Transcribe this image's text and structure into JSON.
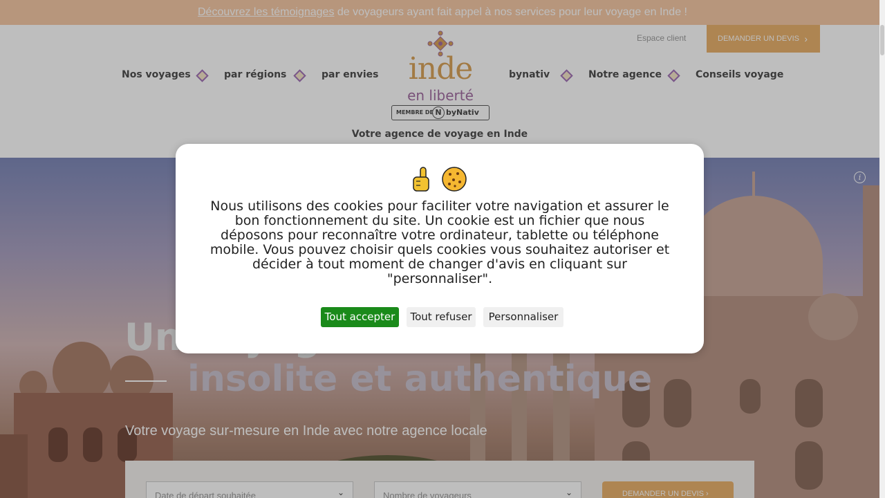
{
  "banner": {
    "link_text": "Découvrez les témoignages",
    "rest_text": " de voyageurs ayant fait appel à nos services pour leur voyage en Inde !"
  },
  "header": {
    "espace_client": "Espace client",
    "devis_button": "DEMANDER UN DEVIS",
    "nav_left": [
      "Nos voyages",
      "par régions",
      "par envies"
    ],
    "nav_right": [
      "bynativ",
      "Notre agence",
      "Conseils voyage"
    ],
    "logo": {
      "line1": "inde",
      "line2": "en liberté",
      "member": "MEMBRE DE",
      "by": "byNativ",
      "n": "N"
    },
    "tagline": "Votre agence de voyage en Inde"
  },
  "hero": {
    "title_line1": "Un voyage",
    "title_line2": "insolite et authentique",
    "subtitle": "Votre voyage sur-mesure en Inde avec notre agence locale",
    "info_icon": "i"
  },
  "form": {
    "date_placeholder": "Date de départ souhaitée",
    "travelers_placeholder": "Nombre de voyageurs",
    "devis_button": "DEMANDER UN DEVIS"
  },
  "cookie_modal": {
    "text": "Nous utilisons des cookies pour faciliter votre navigation et assurer le bon fonctionnement du site. Un cookie est un fichier que nous déposons pour reconnaître votre ordinateur, tablette ou téléphone mobile. Vous pouvez choisir quels cookies vous souhaitez autoriser et décider à tout moment de changer d'avis en cliquant sur \"personnaliser\".",
    "accept_label": "Tout accepter",
    "refuse_label": "Tout refuser",
    "customize_label": "Personnaliser"
  },
  "colors": {
    "banner_bg": "#f6c8a4",
    "accent_orange": "#e9b06a",
    "diamond_purple": "#a070b8",
    "accept_green": "#1a8a1a"
  },
  "icons": [
    "pointing-finger-icon",
    "cookie-icon",
    "info-icon",
    "chevron-right-icon",
    "chevron-down-icon",
    "diamond-separator-icon"
  ]
}
